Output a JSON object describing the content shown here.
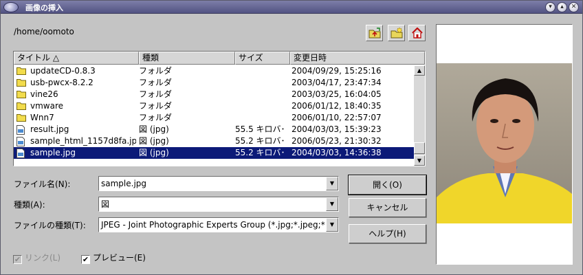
{
  "window": {
    "title": "画像の挿入",
    "controls": [
      "▾",
      "▴",
      "✕"
    ]
  },
  "path": "/home/oomoto",
  "toolbar": {
    "icons": [
      "folder-up-icon",
      "new-folder-icon",
      "home-icon"
    ]
  },
  "file_list": {
    "columns": [
      "タイトル △",
      "種類",
      "サイズ",
      "変更日時"
    ],
    "rows": [
      {
        "name": "updateCD-0.8.3",
        "type": "フォルダ",
        "size": "",
        "date": "2004/09/29, 15:25:16",
        "icon": "folder-icon"
      },
      {
        "name": "usb-pwcx-8.2.2",
        "type": "フォルダ",
        "size": "",
        "date": "2003/04/17, 23:47:34",
        "icon": "folder-icon"
      },
      {
        "name": "vine26",
        "type": "フォルダ",
        "size": "",
        "date": "2003/03/25, 16:04:05",
        "icon": "folder-icon"
      },
      {
        "name": "vmware",
        "type": "フォルダ",
        "size": "",
        "date": "2006/01/12, 18:40:35",
        "icon": "folder-icon"
      },
      {
        "name": "Wnn7",
        "type": "フォルダ",
        "size": "",
        "date": "2006/01/10, 22:57:07",
        "icon": "folder-icon"
      },
      {
        "name": "result.jpg",
        "type": "図 (jpg)",
        "size": "55.5 キロバ･",
        "date": "2004/03/03, 15:39:23",
        "icon": "image-file-icon"
      },
      {
        "name": "sample_html_1157d8fa.jp",
        "type": "図 (jpg)",
        "size": "55.2 キロバ･",
        "date": "2006/05/23, 21:30:32",
        "icon": "image-file-icon"
      },
      {
        "name": "sample.jpg",
        "type": "図 (jpg)",
        "size": "55.2 キロバ･",
        "date": "2004/03/03, 14:36:38",
        "icon": "image-file-icon",
        "selected": true
      }
    ]
  },
  "form": {
    "filename_label": "ファイル名(N):",
    "filename_value": "sample.jpg",
    "kind_label": "種類(A):",
    "kind_value": "図",
    "filetype_label": "ファイルの種類(T):",
    "filetype_value": "JPEG - Joint Photographic Experts Group (*.jpg;*.jpeg;*.jfif;*"
  },
  "buttons": {
    "open": "開く(O)",
    "cancel": "キャンセル",
    "help": "ヘルプ(H)"
  },
  "options": {
    "link_label": "リンク(L)",
    "link_checked": true,
    "link_enabled": false,
    "preview_label": "プレビュー(E)",
    "preview_checked": true
  },
  "colors": {
    "selection": "#0c1a78",
    "titlebar": "#525383"
  }
}
